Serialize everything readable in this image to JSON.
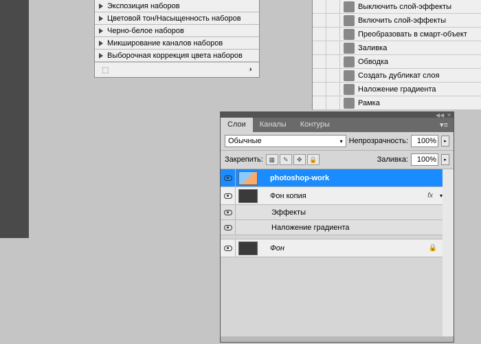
{
  "topPanel": {
    "items": [
      "Экспозиция наборов",
      "Цветовой тон/Насыщенность наборов",
      "Черно-белое наборов",
      "Микширование каналов наборов",
      "Выборочная коррекция цвета наборов"
    ]
  },
  "actions": {
    "items": [
      "Выключить слой-эффекты",
      "Включить слой-эффекты",
      "Преобразовать в смарт-объект",
      "Заливка",
      "Обводка",
      "Создать дубликат слоя",
      "Наложение градиента",
      "Рамка"
    ]
  },
  "layersPanel": {
    "tabs": {
      "layers": "Слои",
      "channels": "Каналы",
      "paths": "Контуры"
    },
    "blendLabel": "Обычные",
    "opacityLabel": "Непрозрачность:",
    "opacityValue": "100%",
    "lockLabel": "Закрепить:",
    "fillLabel": "Заливка:",
    "fillValue": "100%",
    "layers": {
      "l1": "photoshop-work",
      "l2": "Фон копия",
      "fx": "fx",
      "effects": "Эффекты",
      "gradOverlay": "Наложение градиента",
      "bg": "Фон"
    }
  }
}
